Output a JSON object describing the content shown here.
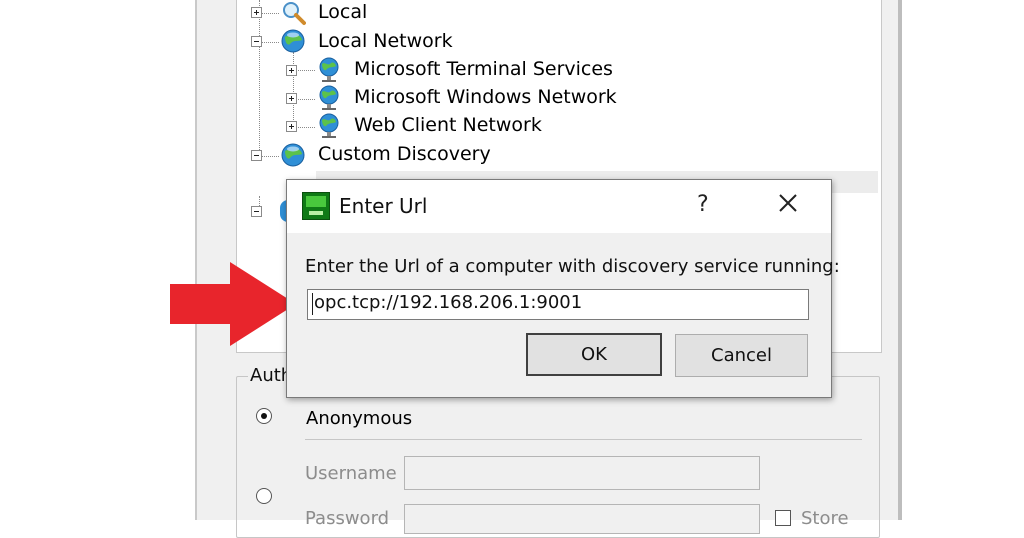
{
  "tree": {
    "nodes": [
      {
        "label": "Local",
        "icon": "magnifier-icon"
      },
      {
        "label": "Local Network",
        "icon": "globe-network-icon"
      },
      {
        "label": "Microsoft Terminal Services",
        "icon": "globe-network-icon"
      },
      {
        "label": "Microsoft Windows Network",
        "icon": "globe-network-icon"
      },
      {
        "label": "Web Client Network",
        "icon": "globe-network-icon"
      },
      {
        "label": "Custom Discovery",
        "icon": "globe-network-icon"
      }
    ]
  },
  "auth": {
    "caption": "Auth",
    "anonymous_label": "Anonymous",
    "username_label": "Username",
    "password_label": "Password",
    "store_label": "Store"
  },
  "dialog": {
    "title": "Enter Url",
    "help": "?",
    "prompt": "Enter the Url of a computer with discovery service running:",
    "url_value": "opc.tcp://192.168.206.1:9001",
    "ok_label": "OK",
    "cancel_label": "Cancel"
  },
  "colors": {
    "arrow": "#e8252c",
    "app_icon": "#0f7a16"
  }
}
